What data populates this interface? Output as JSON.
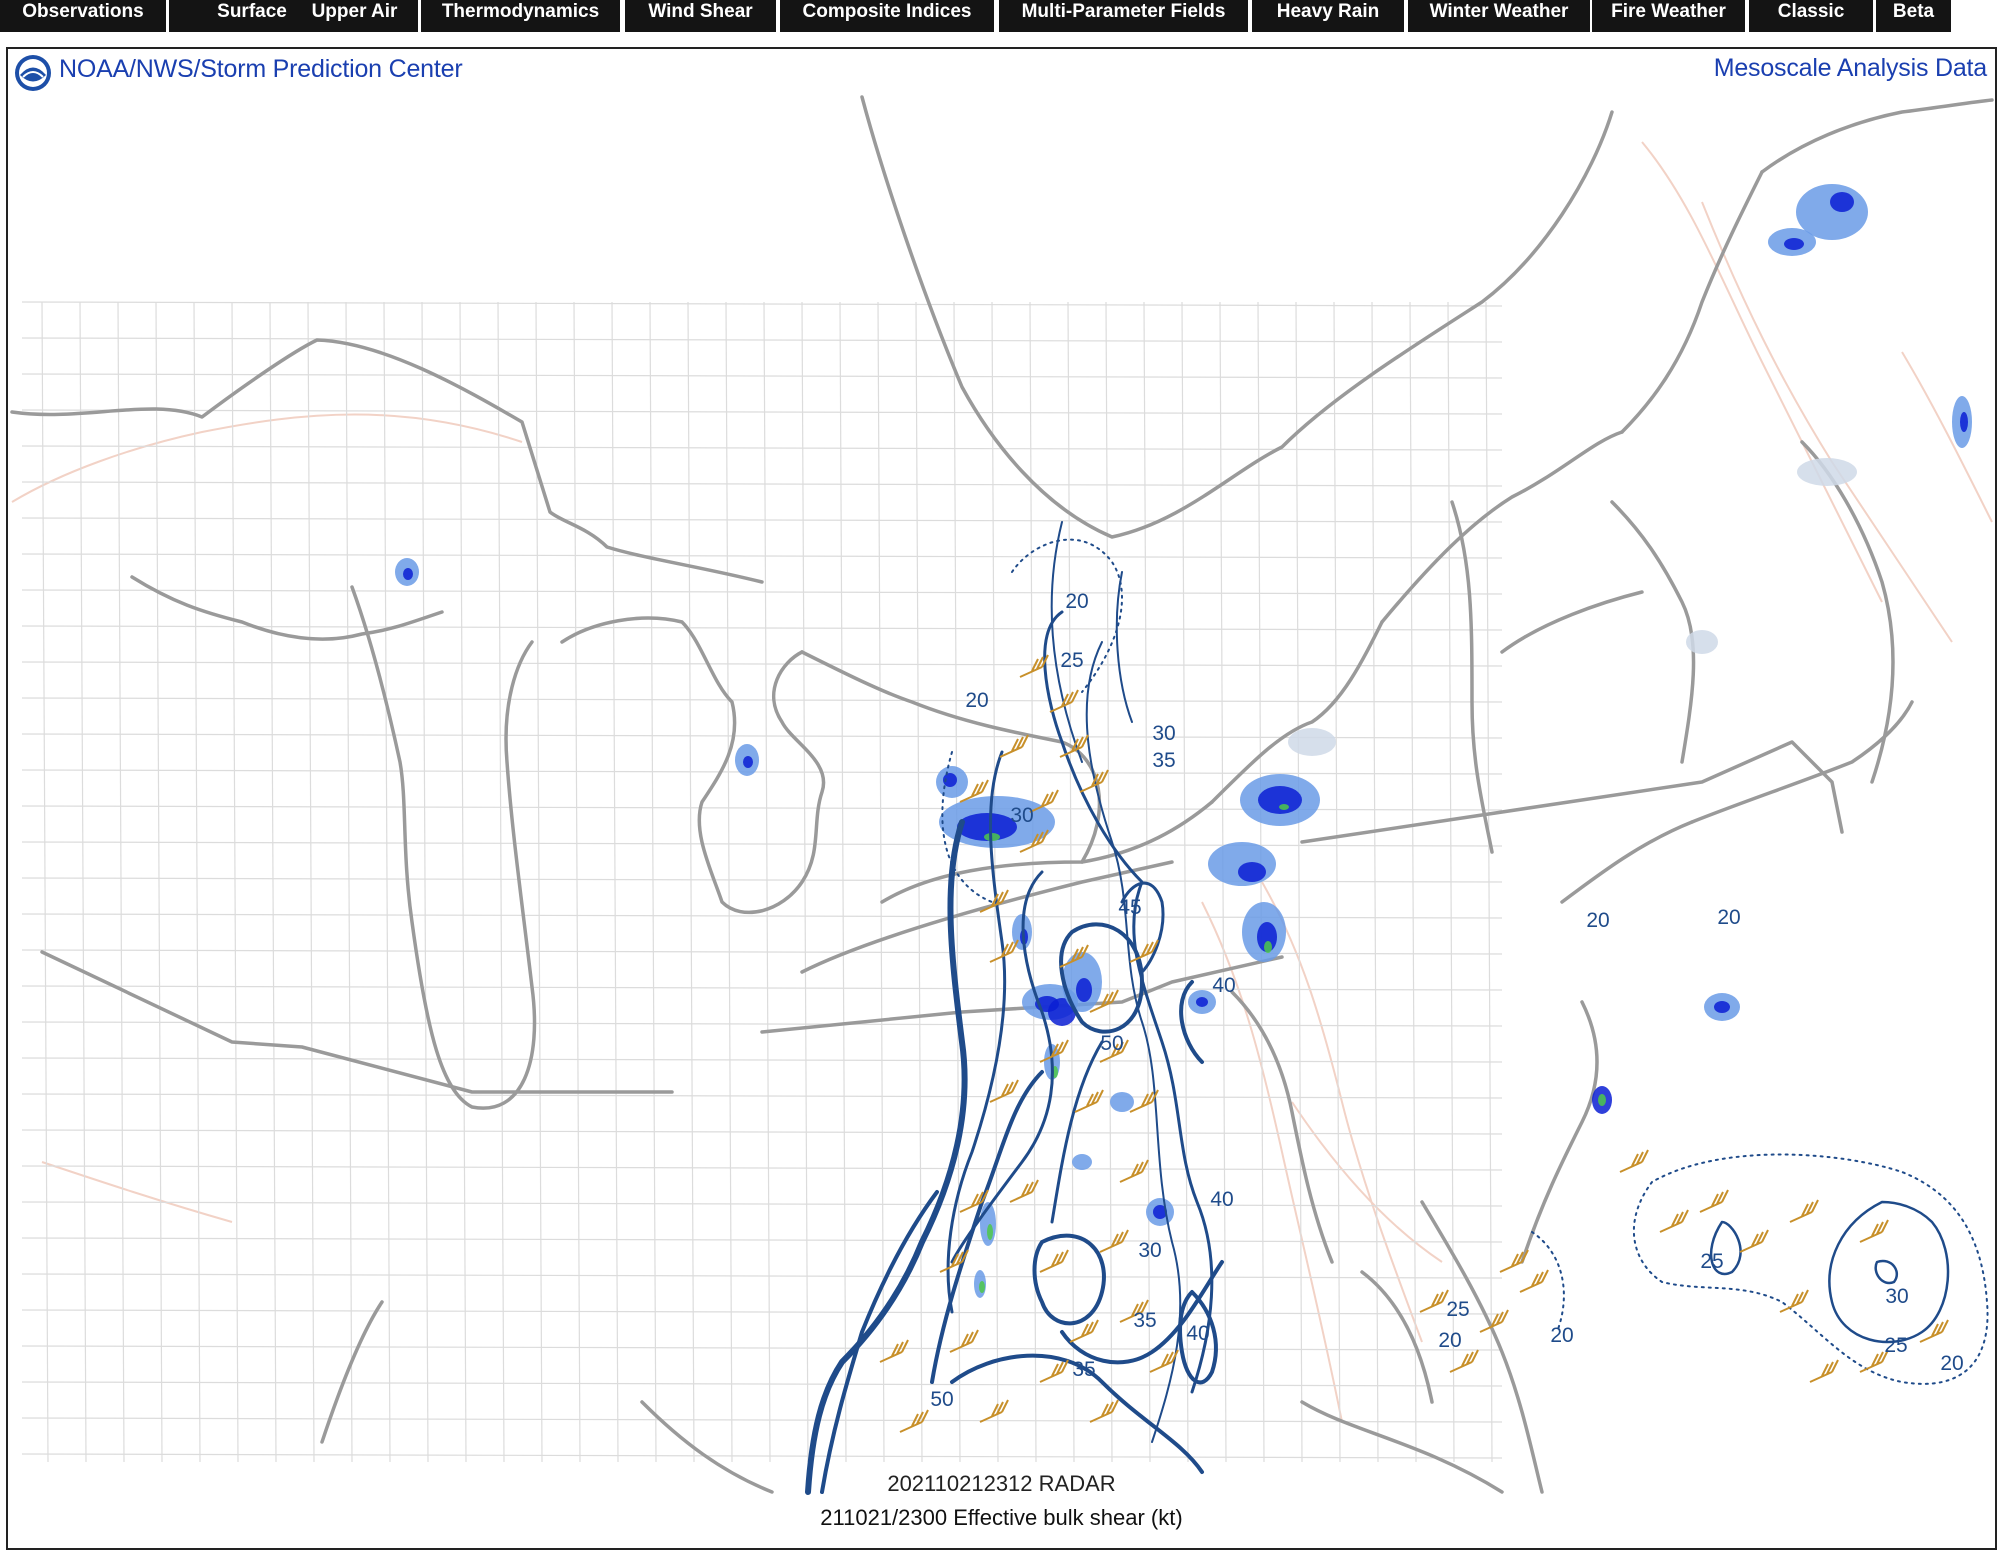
{
  "nav": {
    "tabs": [
      {
        "label": "Observations"
      },
      {
        "label": "Surface"
      },
      {
        "label": "Upper Air"
      },
      {
        "label": "Thermodynamics"
      },
      {
        "label": "Wind Shear"
      },
      {
        "label": "Composite Indices"
      },
      {
        "label": "Multi-Parameter Fields"
      },
      {
        "label": "Heavy Rain"
      },
      {
        "label": "Winter Weather"
      },
      {
        "label": "Fire Weather"
      },
      {
        "label": "Classic"
      },
      {
        "label": "Beta"
      }
    ]
  },
  "header": {
    "brand": "NOAA/NWS/Storm Prediction Center",
    "dataset": "Mesoscale Analysis Data"
  },
  "map": {
    "radar_timestamp": "202110212312 RADAR",
    "caption": "211021/2300 Effective bulk shear (kt)",
    "contour_labels": [
      "20",
      "25",
      "20",
      "30",
      "35",
      "30",
      "45",
      "50",
      "40",
      "40",
      "30",
      "35",
      "35",
      "40",
      "50",
      "20",
      "20",
      "25",
      "30",
      "25",
      "20",
      "20",
      "25",
      "20"
    ],
    "colors": {
      "contour": "#1f4b8a",
      "wind_barb": "#c8902a",
      "radar_light": "#6a9be6",
      "radar_strong": "#0a1fd4",
      "radar_green": "#4ec84a",
      "boundary": "#9a9a9a",
      "county": "#dcdcdc",
      "terrain": "#f2d2c6",
      "brand_text": "#1a3fb0"
    }
  }
}
